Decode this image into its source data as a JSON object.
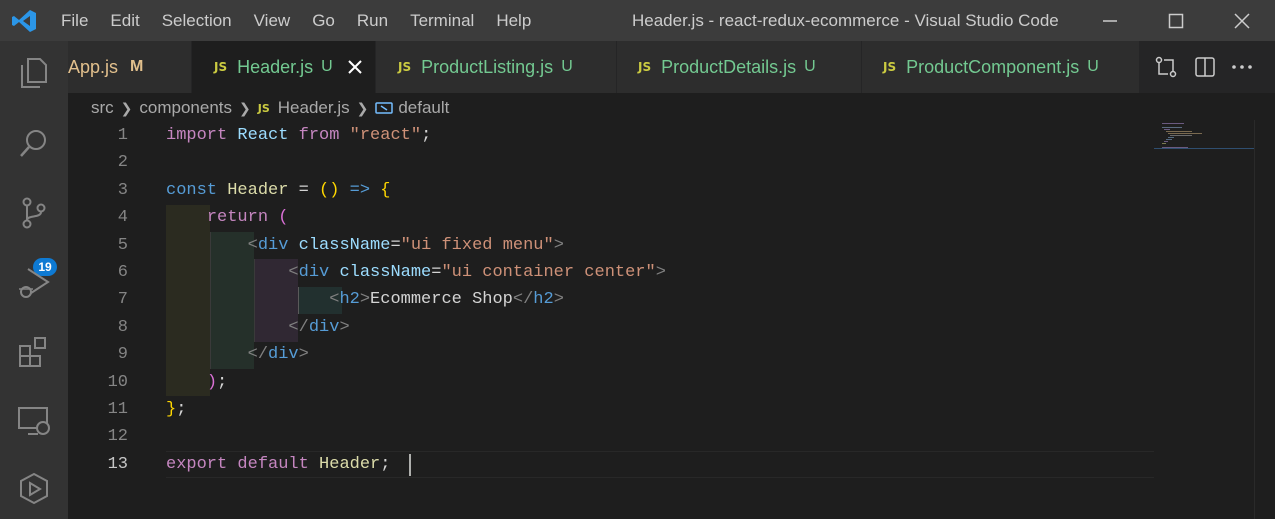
{
  "window": {
    "title": "Header.js - react-redux-ecommerce - Visual Studio Code",
    "logo_icon": "vscode-logo-icon"
  },
  "menu": {
    "items": [
      "File",
      "Edit",
      "Selection",
      "View",
      "Go",
      "Run",
      "Terminal",
      "Help"
    ]
  },
  "activity_bar": {
    "items": [
      {
        "icon": "explorer-icon"
      },
      {
        "icon": "search-icon"
      },
      {
        "icon": "source-control-icon",
        "badge": "19"
      },
      {
        "icon": "run-debug-icon"
      },
      {
        "icon": "extensions-icon"
      },
      {
        "icon": "remote-explorer-icon"
      },
      {
        "icon": "live-share-icon"
      }
    ]
  },
  "tabs": [
    {
      "label": "App.js",
      "flag": "M",
      "state": "modified",
      "active": false
    },
    {
      "label": "Header.js",
      "flag": "U",
      "state": "untracked",
      "active": true
    },
    {
      "label": "ProductListing.js",
      "flag": "U",
      "state": "untracked",
      "active": false
    },
    {
      "label": "ProductDetails.js",
      "flag": "U",
      "state": "untracked",
      "active": false
    },
    {
      "label": "ProductComponent.js",
      "flag": "U",
      "state": "untracked",
      "active": false
    }
  ],
  "file_badge": "JS",
  "breadcrumb": {
    "items": [
      "src",
      "components",
      "Header.js",
      "default"
    ]
  },
  "editor": {
    "current_line": 13,
    "line_numbers": [
      "1",
      "2",
      "3",
      "4",
      "5",
      "6",
      "7",
      "8",
      "9",
      "10",
      "11",
      "12",
      "13"
    ],
    "lines": [
      [
        {
          "t": "import",
          "c": "kw-purple"
        },
        {
          "t": " ",
          "c": "op"
        },
        {
          "t": "React",
          "c": "ident"
        },
        {
          "t": " ",
          "c": "op"
        },
        {
          "t": "from",
          "c": "kw-purple"
        },
        {
          "t": " ",
          "c": "op"
        },
        {
          "t": "\"react\"",
          "c": "str"
        },
        {
          "t": ";",
          "c": "op"
        }
      ],
      [],
      [
        {
          "t": "const",
          "c": "kw-blue"
        },
        {
          "t": " ",
          "c": "op"
        },
        {
          "t": "Header",
          "c": "var"
        },
        {
          "t": " = ",
          "c": "op"
        },
        {
          "t": "()",
          "c": "brace"
        },
        {
          "t": " ",
          "c": "op"
        },
        {
          "t": "=>",
          "c": "kw-blue"
        },
        {
          "t": " ",
          "c": "op"
        },
        {
          "t": "{",
          "c": "brace"
        }
      ],
      [
        {
          "t": "    ",
          "c": "op"
        },
        {
          "t": "return",
          "c": "kw-purple"
        },
        {
          "t": " ",
          "c": "op"
        },
        {
          "t": "(",
          "c": "paren2"
        }
      ],
      [
        {
          "t": "        ",
          "c": "op"
        },
        {
          "t": "<",
          "c": "punct"
        },
        {
          "t": "div",
          "c": "tag"
        },
        {
          "t": " ",
          "c": "op"
        },
        {
          "t": "className",
          "c": "attr"
        },
        {
          "t": "=",
          "c": "op"
        },
        {
          "t": "\"ui fixed menu\"",
          "c": "str"
        },
        {
          "t": ">",
          "c": "punct"
        }
      ],
      [
        {
          "t": "            ",
          "c": "op"
        },
        {
          "t": "<",
          "c": "punct"
        },
        {
          "t": "div",
          "c": "tag"
        },
        {
          "t": " ",
          "c": "op"
        },
        {
          "t": "className",
          "c": "attr"
        },
        {
          "t": "=",
          "c": "op"
        },
        {
          "t": "\"ui container center\"",
          "c": "str"
        },
        {
          "t": ">",
          "c": "punct"
        }
      ],
      [
        {
          "t": "                ",
          "c": "op"
        },
        {
          "t": "<",
          "c": "punct"
        },
        {
          "t": "h2",
          "c": "tag"
        },
        {
          "t": ">",
          "c": "punct"
        },
        {
          "t": "Ecommerce Shop",
          "c": "op"
        },
        {
          "t": "</",
          "c": "punct"
        },
        {
          "t": "h2",
          "c": "tag"
        },
        {
          "t": ">",
          "c": "punct"
        }
      ],
      [
        {
          "t": "            ",
          "c": "op"
        },
        {
          "t": "</",
          "c": "punct"
        },
        {
          "t": "div",
          "c": "tag"
        },
        {
          "t": ">",
          "c": "punct"
        }
      ],
      [
        {
          "t": "        ",
          "c": "op"
        },
        {
          "t": "</",
          "c": "punct"
        },
        {
          "t": "div",
          "c": "tag"
        },
        {
          "t": ">",
          "c": "punct"
        }
      ],
      [
        {
          "t": "    ",
          "c": "op"
        },
        {
          "t": ")",
          "c": "paren2"
        },
        {
          "t": ";",
          "c": "op"
        }
      ],
      [
        {
          "t": "}",
          "c": "brace"
        },
        {
          "t": ";",
          "c": "op"
        }
      ],
      [],
      [
        {
          "t": "export",
          "c": "kw-purple"
        },
        {
          "t": " ",
          "c": "op"
        },
        {
          "t": "default",
          "c": "kw-purple"
        },
        {
          "t": " ",
          "c": "op"
        },
        {
          "t": "Header",
          "c": "var"
        },
        {
          "t": ";",
          "c": "op"
        }
      ]
    ]
  },
  "colors": {
    "titlebar": "#3c3c3c",
    "activitybar": "#333333",
    "editor_bg": "#1e1e1e",
    "badge": "#0e7ad3",
    "modified": "#e2c08d",
    "untracked": "#73c991",
    "js_badge": "#cbcb41"
  }
}
